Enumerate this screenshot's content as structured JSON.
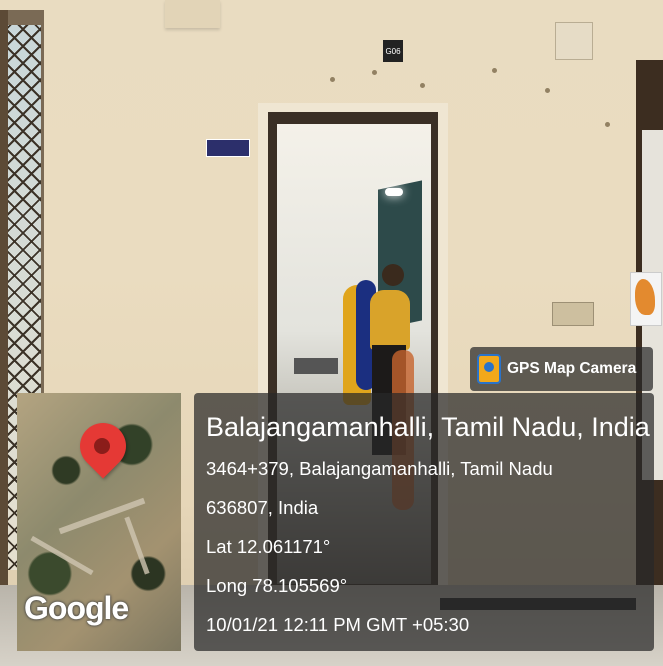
{
  "badge": {
    "label": "GPS Map Camera",
    "icon": "gps-map-camera-icon"
  },
  "location": {
    "title": "Balajangamanhalli, Tamil Nadu, India",
    "address_line1": "3464+379, Balajangamanhalli, Tamil Nadu",
    "address_line2": "636807, India",
    "lat": "Lat 12.061171°",
    "long": "Long 78.105569°",
    "datetime": "10/01/21 12:11 PM GMT +05:30"
  },
  "map": {
    "logo_text": "Google",
    "pin_color": "#e53935"
  },
  "scene": {
    "room_sign": "G06"
  }
}
